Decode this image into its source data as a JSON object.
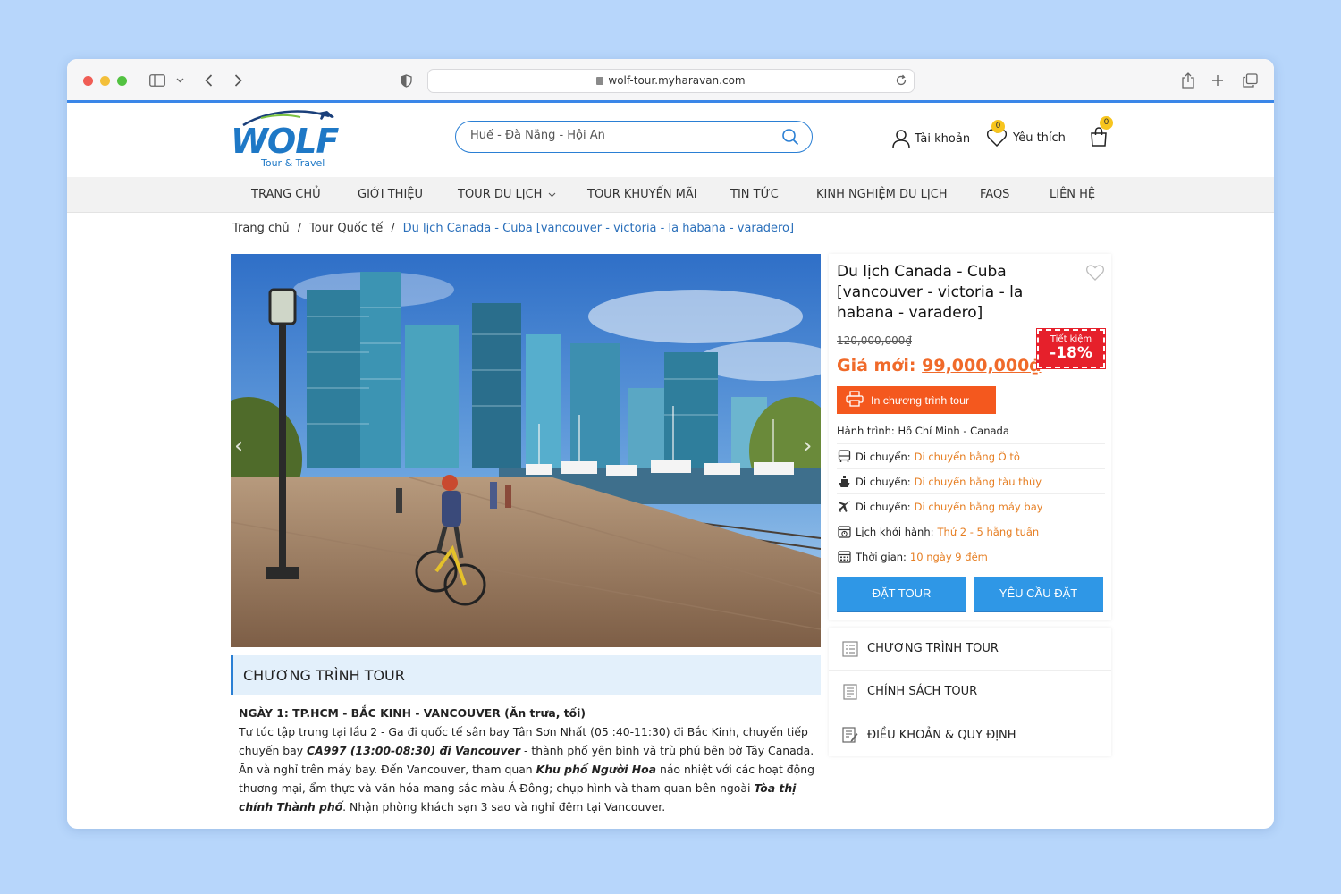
{
  "browser": {
    "url": "wolf-tour.myharavan.com"
  },
  "header": {
    "logo_word": "WOLF",
    "logo_sub": "Tour & Travel",
    "search_placeholder": "Huế - Đà Nẵng - Hội An",
    "account_label": "Tài khoản",
    "wishlist_label": "Yêu thích",
    "wishlist_count": "0",
    "cart_count": "0"
  },
  "nav": {
    "items": [
      "TRANG CHỦ",
      "GIỚI THIỆU",
      "TOUR DU LỊCH",
      "TOUR KHUYẾN MÃI",
      "TIN TỨC",
      "KINH NGHIỆM DU LỊCH",
      "FAQS",
      "LIÊN HỆ"
    ]
  },
  "breadcrumb": {
    "home": "Trang chủ",
    "category": "Tour Quốc tế",
    "current": "Du lịch Canada - Cuba [vancouver - victoria - la habana - varadero]"
  },
  "tour": {
    "title": "Du lịch Canada - Cuba [vancouver - victoria - la habana - varadero]",
    "old_price": "120,000,000₫",
    "new_price_label": "Giá mới:",
    "new_price": "99,000,000₫",
    "save_label": "Tiết kiệm",
    "save_percent": "-18%",
    "print_label": "In chương trình tour",
    "route_label": "Hành trình:",
    "route_value": "Hồ Chí Minh - Canada",
    "rows": [
      {
        "icon": "bus-icon",
        "label": "Di chuyển:",
        "value": "Di chuyển bằng Ô tô"
      },
      {
        "icon": "ship-icon",
        "label": "Di chuyển:",
        "value": "Di chuyển bằng tàu thủy"
      },
      {
        "icon": "plane-icon",
        "label": "Di chuyển:",
        "value": "Di chuyển bằng máy bay"
      },
      {
        "icon": "schedule-icon",
        "label": "Lịch khởi hành:",
        "value": "Thứ 2 - 5 hằng tuần"
      },
      {
        "icon": "calendar-icon",
        "label": "Thời gian:",
        "value": "10 ngày 9 đêm"
      }
    ],
    "book_label": "ĐẶT TOUR",
    "request_label": "YÊU CẦU ĐẶT"
  },
  "side_menu": {
    "items": [
      "CHƯƠNG TRÌNH TOUR",
      "CHÍNH SÁCH TOUR",
      "ĐIỀU KHOẢN & QUY ĐỊNH"
    ]
  },
  "program": {
    "heading": "CHƯƠNG TRÌNH TOUR",
    "day1_title": "NGÀY 1: TP.HCM - BẮC KINH - VANCOUVER (Ăn trưa, tối)",
    "p1": "Tự  túc tập trung tại lầu 2 - Ga đi quốc tế sân bay Tân Sơn Nhất (05 :40-11:30) đi Bắc Kinh, chuyến tiếp chuyến bay ",
    "p1_flight": "CA997 (13:00-08:30) đi Vancouver",
    "p2": " - thành phố yên bình và trù phú bên bờ Tây Canada. Ăn và nghỉ trên máy bay. Đến Vancouver, tham quan ",
    "p2_place": "Khu phố Người Hoa",
    "p3": " náo nhiệt với các hoạt động thương mại, ẩm thực và văn hóa mang sắc màu Á Đông; chụp hình và tham quan bên ngoài ",
    "p3_place": "Tòa thị chính Thành phố",
    "p4": ". Nhận phòng khách sạn 3 sao và nghỉ đêm tại Vancouver."
  },
  "colors": {
    "accent_blue": "#2f97e6",
    "price_orange": "#f06a2a",
    "save_red": "#e6202b",
    "print_orange": "#f4581e"
  }
}
